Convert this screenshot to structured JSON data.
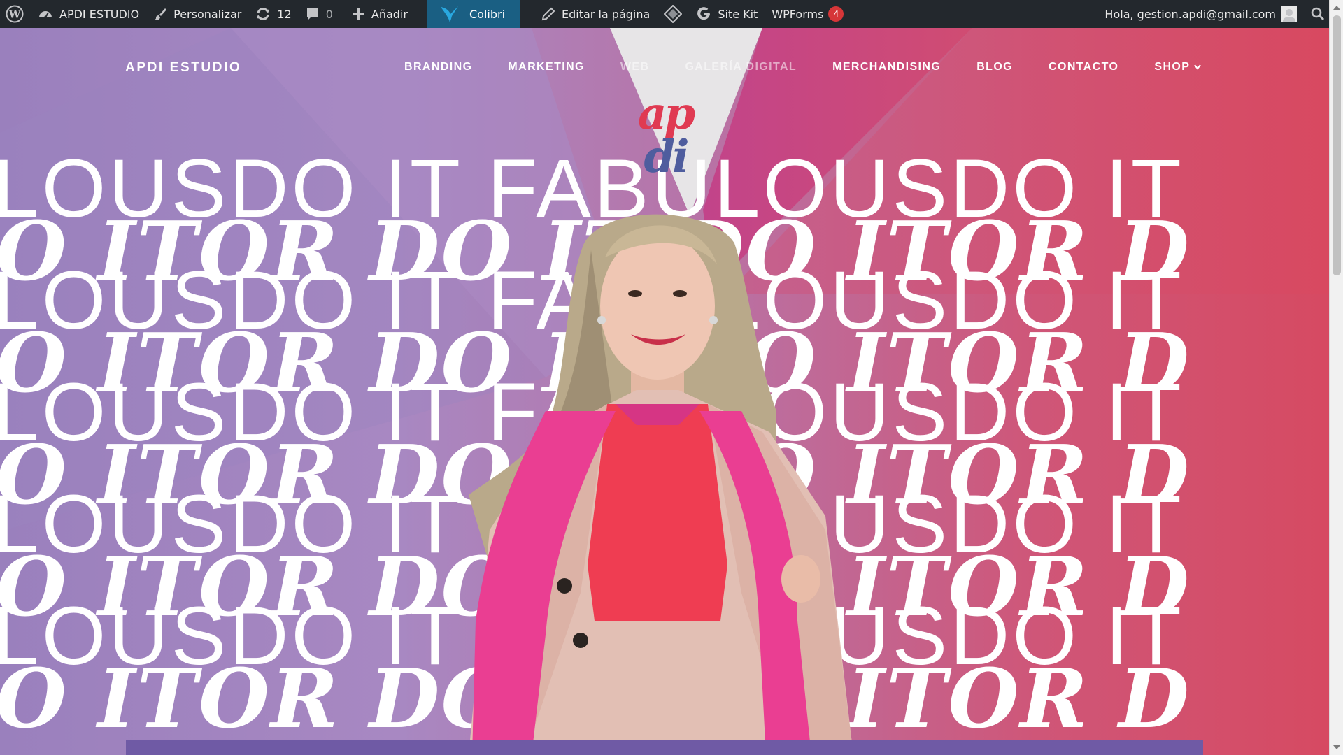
{
  "adminbar": {
    "site_name": "APDI ESTUDIO",
    "customize": "Personalizar",
    "updates_count": "12",
    "comments_count": "0",
    "add_new": "Añadir",
    "colibri": "Colibri",
    "edit_page": "Editar la página",
    "site_kit": "Site Kit",
    "wpforms": "WPForms",
    "wpforms_badge": "4",
    "greeting": "Hola, gestion.apdi@gmail.com",
    "icons": [
      "wordpress-icon",
      "dashboard-icon",
      "brush-icon",
      "refresh-icon",
      "comment-icon",
      "plus-icon",
      "colibri-bird-icon",
      "pencil-icon",
      "diamond-icon",
      "google-icon",
      "search-icon"
    ]
  },
  "site": {
    "brand": "APDI ESTUDIO",
    "logo_line1": "ap",
    "logo_line2": "di",
    "nav": [
      "BRANDING",
      "MARKETING",
      "WEB",
      "GALERÍA DIGITAL",
      "MERCHANDISING",
      "BLOG",
      "CONTACTO",
      "SHOP"
    ]
  },
  "hero": {
    "text_sans": "LOUSDO IT FABULOUSDO IT",
    "text_serif": "O ITOR DO IT DO ITOR D",
    "colors": {
      "purple": "#9a80bd",
      "pink": "#c94a84",
      "red": "#d64a62",
      "logo_red": "#e03a52",
      "logo_blue": "#4f5d9e",
      "bottom_bar": "#6f5aa5"
    }
  }
}
